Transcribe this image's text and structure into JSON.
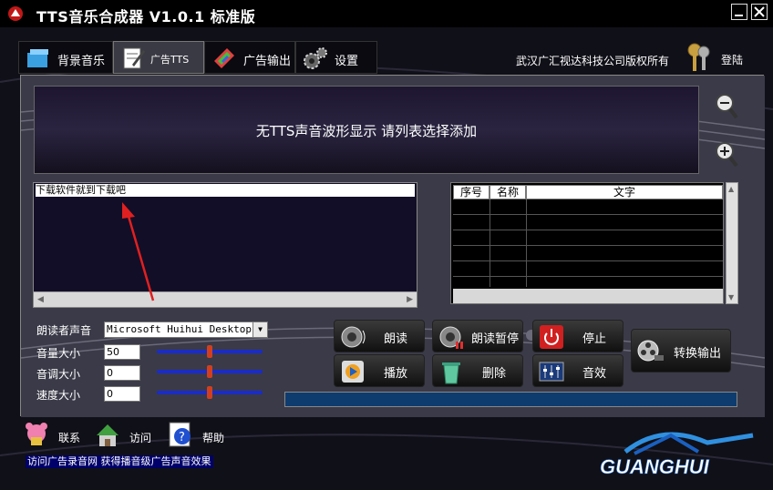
{
  "window": {
    "title": "TTS音乐合成器 V1.0.1 标准版"
  },
  "tabs": [
    {
      "label": "背景音乐",
      "icon": "music-box-icon"
    },
    {
      "label": "广告TTS",
      "icon": "notepad-pencil-icon"
    },
    {
      "label": "广告输出",
      "icon": "colorful-pencil-icon"
    },
    {
      "label": "设置",
      "icon": "gears-icon"
    }
  ],
  "header": {
    "copyright": "武汉广汇视达科技公司版权所有",
    "login_label": "登陆"
  },
  "waveform": {
    "message": "无TTS声音波形显示    请列表选择添加"
  },
  "editor": {
    "text": "下载软件就到下载吧"
  },
  "table": {
    "columns": [
      "序号",
      "名称",
      "文字"
    ],
    "rows": []
  },
  "settings": {
    "voice_label": "朗读者声音",
    "voice_value": "Microsoft Huihui Desktop -",
    "volume_label": "音量大小",
    "volume_value": "50",
    "volume_level": 0.5,
    "pitch_label": "音调大小",
    "pitch_value": "0",
    "pitch_level": 0.5,
    "speed_label": "速度大小",
    "speed_value": "0",
    "speed_level": 0.5
  },
  "actions": {
    "read": "朗读",
    "pause": "朗读暂停",
    "stop": "停止",
    "play": "播放",
    "delete": "删除",
    "effects": "音效",
    "convert": "转换输出"
  },
  "footer": {
    "contact": "联系",
    "visit": "访问",
    "help": "帮助",
    "marquee": "访问广告录音网 获得播音级广告声音效果",
    "brand": "GUANGHUI"
  }
}
